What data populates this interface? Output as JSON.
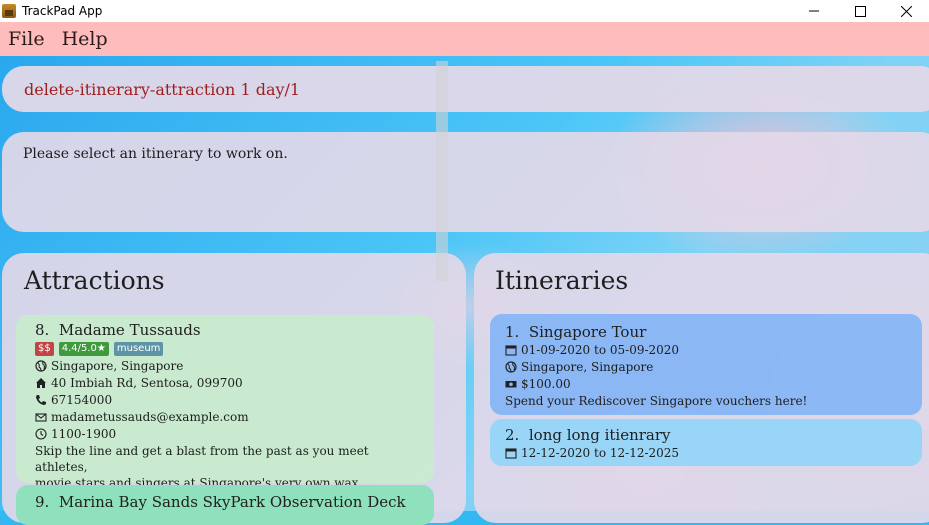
{
  "window": {
    "title": "TrackPad App"
  },
  "menu": {
    "file": "File",
    "help": "Help"
  },
  "command": {
    "value": "delete-itinerary-attraction 1 day/1"
  },
  "result": {
    "message": "Please select an itinerary to work on."
  },
  "attractions": {
    "title": "Attractions",
    "cards": [
      {
        "index": "8.",
        "name": "Madame Tussauds",
        "price": "$$",
        "rating": "4.4/5.0★",
        "tag": "museum",
        "location": "Singapore, Singapore",
        "address": "40 Imbiah Rd, Sentosa, 099700",
        "phone": "67154000",
        "email": "madametussauds@example.com",
        "hours": "1100-1900",
        "description_line1": "Skip the line and get a blast from the past as you meet athletes,",
        "description_line2": "movie stars and singers at Singapore's very own wax museum!"
      },
      {
        "index": "9.",
        "name": "Marina Bay Sands SkyPark Observation Deck"
      }
    ]
  },
  "itineraries": {
    "title": "Itineraries",
    "cards": [
      {
        "index": "1.",
        "name": "Singapore Tour",
        "dates": "01-09-2020 to 05-09-2020",
        "location": "Singapore, Singapore",
        "budget": "$100.00",
        "description": "Spend your Rediscover Singapore vouchers here!"
      },
      {
        "index": "2.",
        "name": "long long itienrary",
        "dates": "12-12-2020 to 12-12-2025"
      }
    ]
  },
  "colors": {
    "menubar": "#ffbcbd",
    "command_text": "#9d1e1e",
    "attraction_card": "#c8ecd0",
    "attraction_card_selected": "#8fe0bd",
    "itinerary_card": "#87b6f6",
    "itinerary_card_alt": "#96d4f7"
  }
}
